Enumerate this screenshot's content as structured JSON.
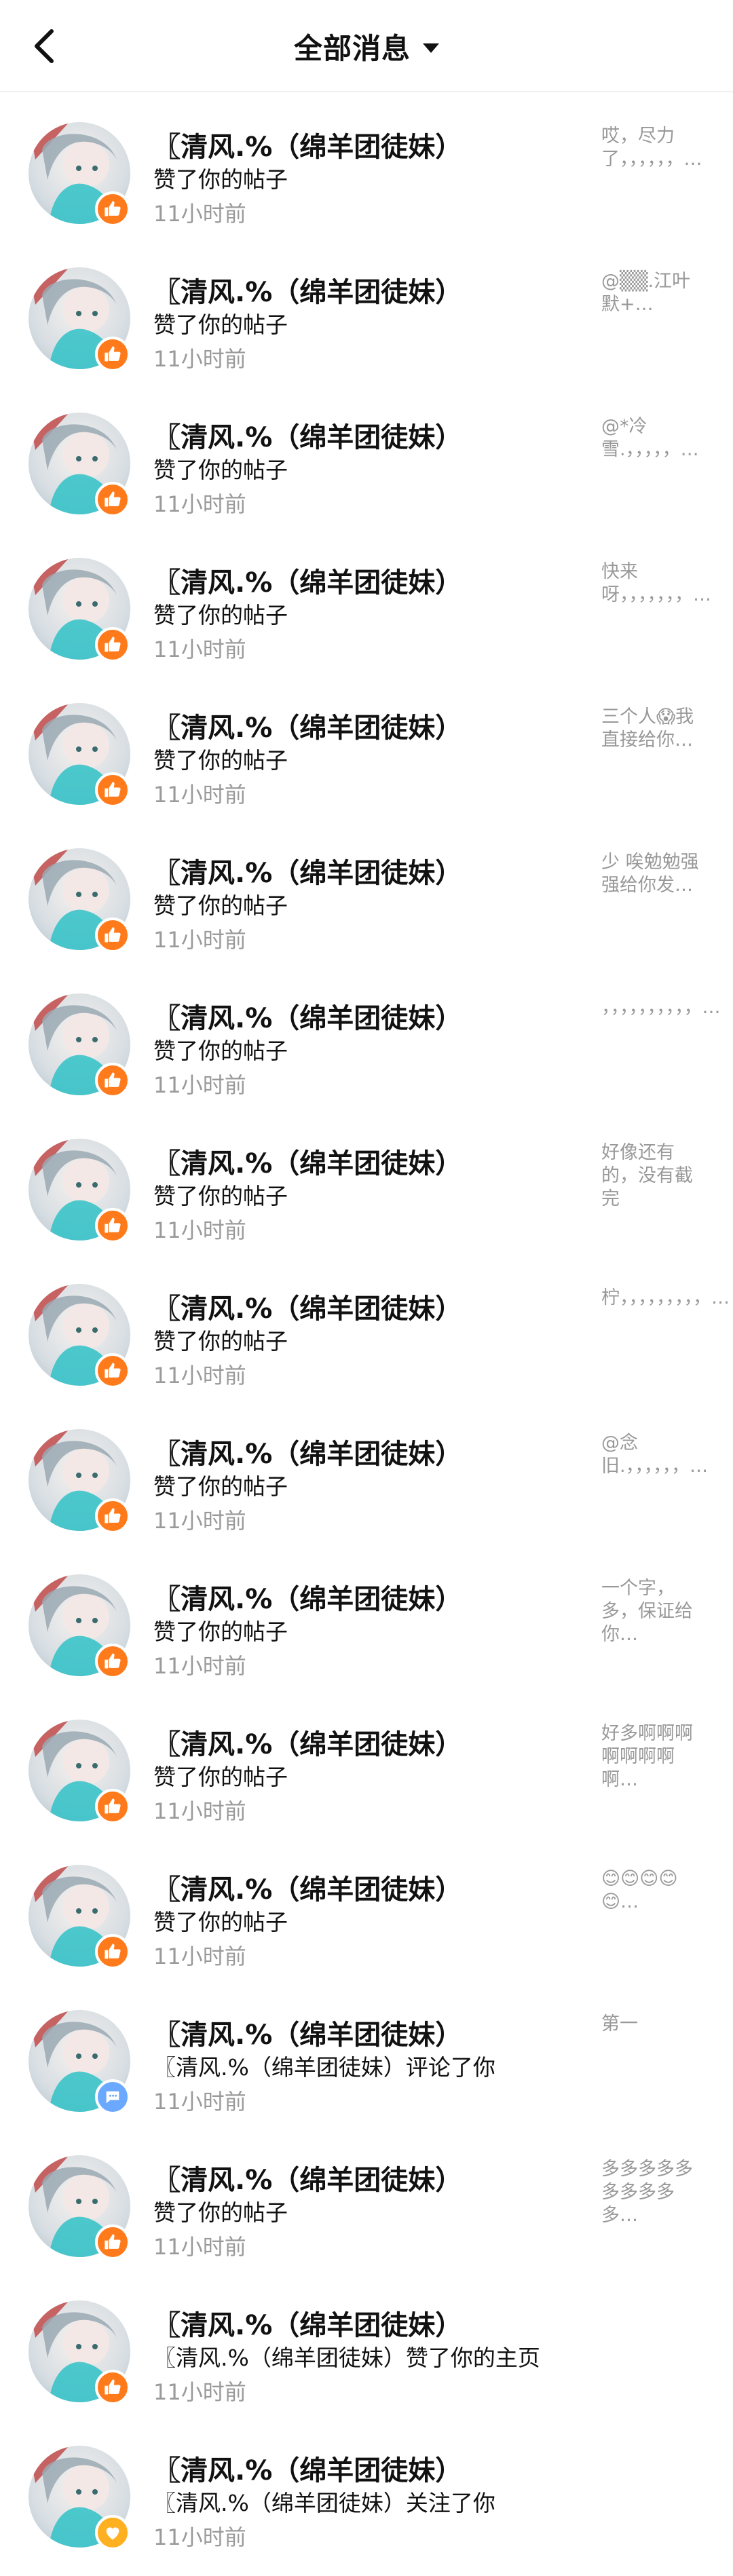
{
  "header": {
    "title": "全部消息"
  },
  "items": [
    {
      "name": "〖清风.%（绵羊团徒妹）",
      "action": "赞了你的帖子",
      "time": "11小时前",
      "preview": "哎，尽力了，，，，，，…",
      "badge": "like"
    },
    {
      "name": "〖清风.%（绵羊团徒妹）",
      "action": "赞了你的帖子",
      "time": "11小时前",
      "preview": "@▒▒.江叶默+…",
      "badge": "like"
    },
    {
      "name": "〖清风.%（绵羊团徒妹）",
      "action": "赞了你的帖子",
      "time": "11小时前",
      "preview": "@*冷雪.，，，，，…",
      "badge": "like"
    },
    {
      "name": "〖清风.%（绵羊团徒妹）",
      "action": "赞了你的帖子",
      "time": "11小时前",
      "preview": "快来呀，，，，，，，…",
      "badge": "like"
    },
    {
      "name": "〖清风.%（绵羊团徒妹）",
      "action": "赞了你的帖子",
      "time": "11小时前",
      "preview": "三个人😱我直接给你…",
      "badge": "like"
    },
    {
      "name": "〖清风.%（绵羊团徒妹）",
      "action": "赞了你的帖子",
      "time": "11小时前",
      "preview": "少 唉勉勉强强给你发…",
      "badge": "like"
    },
    {
      "name": "〖清风.%（绵羊团徒妹）",
      "action": "赞了你的帖子",
      "time": "11小时前",
      "preview": "，，，，，，，，，，…",
      "badge": "like"
    },
    {
      "name": "〖清风.%（绵羊团徒妹）",
      "action": "赞了你的帖子",
      "time": "11小时前",
      "preview": "好像还有的，没有截完",
      "badge": "like"
    },
    {
      "name": "〖清风.%（绵羊团徒妹）",
      "action": "赞了你的帖子",
      "time": "11小时前",
      "preview": "柠，，，，，，，，，…",
      "badge": "like"
    },
    {
      "name": "〖清风.%（绵羊团徒妹）",
      "action": "赞了你的帖子",
      "time": "11小时前",
      "preview": "@念旧.，，，，，，…",
      "badge": "like"
    },
    {
      "name": "〖清风.%（绵羊团徒妹）",
      "action": "赞了你的帖子",
      "time": "11小时前",
      "preview": "一个字，多，保证给你…",
      "badge": "like"
    },
    {
      "name": "〖清风.%（绵羊团徒妹）",
      "action": "赞了你的帖子",
      "time": "11小时前",
      "preview": "好多啊啊啊啊啊啊啊啊…",
      "badge": "like"
    },
    {
      "name": "〖清风.%（绵羊团徒妹）",
      "action": "赞了你的帖子",
      "time": "11小时前",
      "preview": "😊😊😊😊😊…",
      "badge": "like"
    },
    {
      "name": "〖清风.%（绵羊团徒妹）",
      "action": "〖清风.%（绵羊团徒妹）评论了你",
      "time": "11小时前",
      "preview": "第一",
      "badge": "comment"
    },
    {
      "name": "〖清风.%（绵羊团徒妹）",
      "action": "赞了你的帖子",
      "time": "11小时前",
      "preview": "多多多多多多多多多多…",
      "badge": "like"
    },
    {
      "name": "〖清风.%（绵羊团徒妹）",
      "action": "〖清风.%（绵羊团徒妹）赞了你的主页",
      "time": "11小时前",
      "preview": "",
      "badge": "like"
    },
    {
      "name": "〖清风.%（绵羊团徒妹）",
      "action": "〖清风.%（绵羊团徒妹）关注了你",
      "time": "11小时前",
      "preview": "",
      "badge": "follow"
    }
  ]
}
